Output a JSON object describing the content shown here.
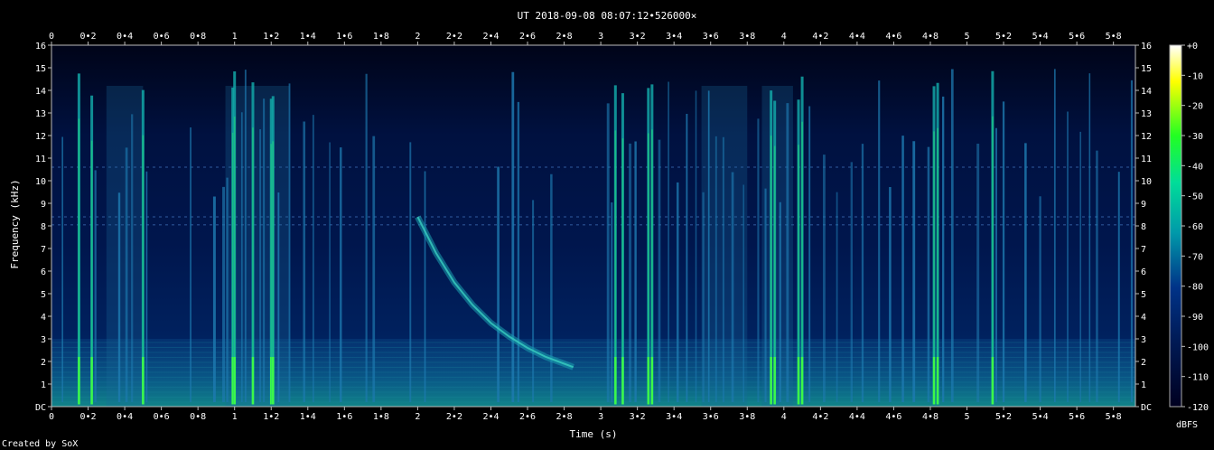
{
  "footer": {
    "credit": "Created by SoX"
  },
  "colorbar": {
    "unit": "dBFS",
    "ticks": [
      "+0",
      "-10",
      "-20",
      "-30",
      "-40",
      "-50",
      "-60",
      "-70",
      "-80",
      "-90",
      "-100",
      "-110",
      "-120"
    ],
    "colors": [
      "#ffffff",
      "#ffff00",
      "#22ff22",
      "#00dd99",
      "#0099aa",
      "#003388",
      "#000020"
    ]
  },
  "chart_data": {
    "type": "heatmap",
    "title": "UT 2018-09-08 08:07:12•526000×",
    "xlabel": "Time (s)",
    "ylabel": "Frequency (kHz)",
    "xlim": [
      0,
      5.92
    ],
    "ylim": [
      0,
      16
    ],
    "z_range_dbfs": [
      -120,
      0
    ],
    "x_ticks": [
      0,
      0.2,
      0.4,
      0.6,
      0.8,
      1,
      1.2,
      1.4,
      1.6,
      1.8,
      2,
      2.2,
      2.4,
      2.6,
      2.8,
      3,
      3.2,
      3.4,
      3.6,
      3.8,
      4,
      4.2,
      4.4,
      4.6,
      4.8,
      5,
      5.2,
      5.4,
      5.6,
      5.8
    ],
    "x_tick_labels": [
      "0",
      "0•2",
      "0•4",
      "0•6",
      "0•8",
      "1",
      "1•2",
      "1•4",
      "1•6",
      "1•8",
      "2",
      "2•2",
      "2•4",
      "2•6",
      "2•8",
      "3",
      "3•2",
      "3•4",
      "3•6",
      "3•8",
      "4",
      "4•2",
      "4•4",
      "4•6",
      "4•8",
      "5",
      "5•2",
      "5•4",
      "5•6",
      "5•8"
    ],
    "y_ticks": [
      0,
      1,
      2,
      3,
      4,
      5,
      6,
      7,
      8,
      9,
      10,
      11,
      12,
      13,
      14,
      15,
      16
    ],
    "y_tick_labels": [
      "DC",
      "1",
      "2",
      "3",
      "4",
      "5",
      "6",
      "7",
      "8",
      "9",
      "10",
      "11",
      "12",
      "13",
      "14",
      "15",
      "16"
    ],
    "features": {
      "strong_broadband_clicks_s": [
        0.15,
        0.22,
        0.5,
        0.99,
        1.0,
        1.1,
        1.2,
        1.21,
        3.08,
        3.12,
        3.26,
        3.28,
        3.93,
        3.95,
        4.08,
        4.1,
        4.82,
        4.84,
        5.14
      ],
      "medium_clicks_s": [
        0.06,
        0.24,
        0.37,
        0.41,
        0.44,
        0.52,
        0.76,
        0.89,
        0.94,
        0.96,
        1.04,
        1.06,
        1.14,
        1.16,
        1.24,
        1.3,
        1.38,
        1.43,
        1.52,
        1.58,
        1.72,
        1.76,
        1.96,
        2.04,
        2.44,
        2.52,
        2.55,
        2.63,
        2.73,
        3.04,
        3.06,
        3.16,
        3.19,
        3.32,
        3.37,
        3.42,
        3.47,
        3.52,
        3.56,
        3.59,
        3.63,
        3.67,
        3.72,
        3.78,
        3.86,
        3.9,
        3.98,
        4.02,
        4.14,
        4.22,
        4.29,
        4.37,
        4.43,
        4.52,
        4.58,
        4.65,
        4.71,
        4.79,
        4.87,
        4.92,
        5.06,
        5.16,
        5.2,
        5.32,
        5.4,
        5.48,
        5.55,
        5.62,
        5.67,
        5.71,
        5.83,
        5.9
      ],
      "dense_regions_s": [
        [
          0.3,
          0.5
        ],
        [
          0.95,
          1.3
        ],
        [
          3.55,
          3.8
        ],
        [
          3.88,
          4.05
        ]
      ],
      "sweep_khz": {
        "t": [
          2.0,
          2.1,
          2.2,
          2.3,
          2.4,
          2.5,
          2.6,
          2.7,
          2.8,
          2.85
        ],
        "f": [
          8.4,
          6.8,
          5.5,
          4.5,
          3.7,
          3.1,
          2.6,
          2.2,
          1.9,
          1.75
        ]
      },
      "tonal_line_khz": [
        10.6,
        8.05,
        8.4
      ],
      "low_band_khz": [
        0,
        3
      ]
    }
  }
}
